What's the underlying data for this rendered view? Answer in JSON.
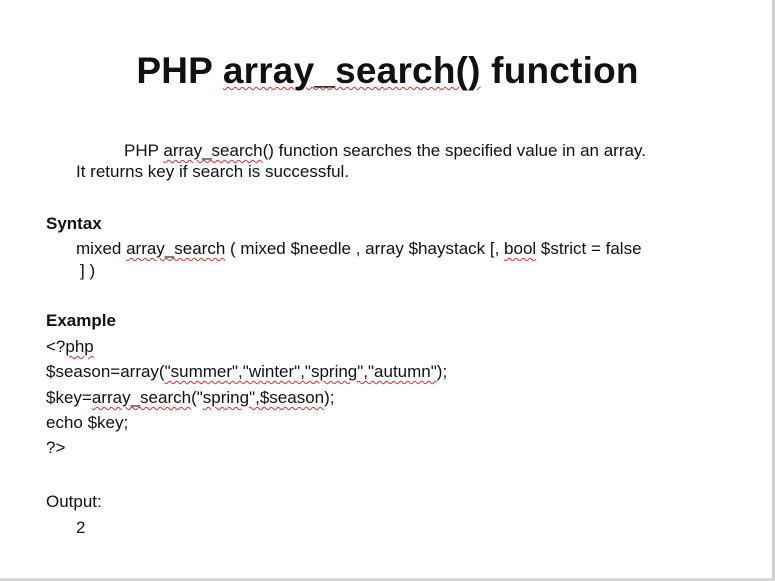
{
  "title": {
    "pre": "PHP ",
    "fn": "array_search()",
    "post": " function"
  },
  "intro": {
    "l1_pre": "PHP ",
    "l1_fn": "array_search",
    "l1_post": "() function searches the specified value in an array.",
    "l2": "It returns key if search is successful."
  },
  "syntax": {
    "heading": "Syntax",
    "s1": "mixed ",
    "s2": "array_search",
    "s3": " ( mixed $needle  , array $haystack [, ",
    "s4": "bool",
    "s5": " $strict = false",
    "s6": "] )"
  },
  "example": {
    "heading": "Example",
    "c1a": "<?",
    "c1b": "php",
    "c2a": "$season=array(",
    "c2b": "\"summer\",\"winter\",\"spring\",\"autumn\"",
    "c2c": ");",
    "c3a": "$key=",
    "c3b": "array_search",
    "c3c": "(\"",
    "c3d": "spring\",$season",
    "c3e": ");",
    "c4": "echo $key;",
    "c5": "?>"
  },
  "output": {
    "label": "Output:",
    "value": "2"
  }
}
